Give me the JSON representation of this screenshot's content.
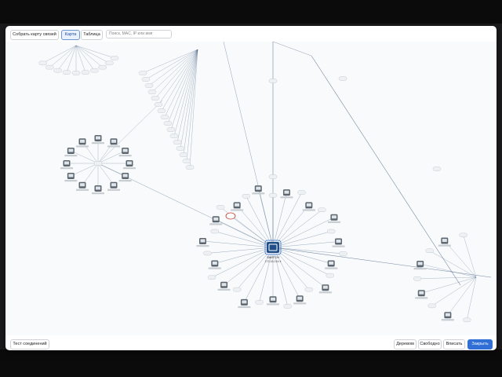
{
  "toolbar": {
    "build_map_label": "Собрать карту связей",
    "tab_map_label": "Карта",
    "tab_table_label": "Таблица",
    "search_placeholder": "Поиск, MAC, IP или имя"
  },
  "center_device": {
    "name": "SWITCH",
    "ip": "172.16.214.4",
    "selected": true
  },
  "footer": {
    "test_connections_label": "Тест соединений",
    "tree_label": "Деревом",
    "free_label": "Свободно",
    "fit_label": "Вписать",
    "close_label": "Закрыть"
  },
  "colors": {
    "accent": "#2f6fd6",
    "selected_node": "#1f4f86",
    "edge": "#3c5a7a",
    "alert_node": "#c0392b"
  }
}
